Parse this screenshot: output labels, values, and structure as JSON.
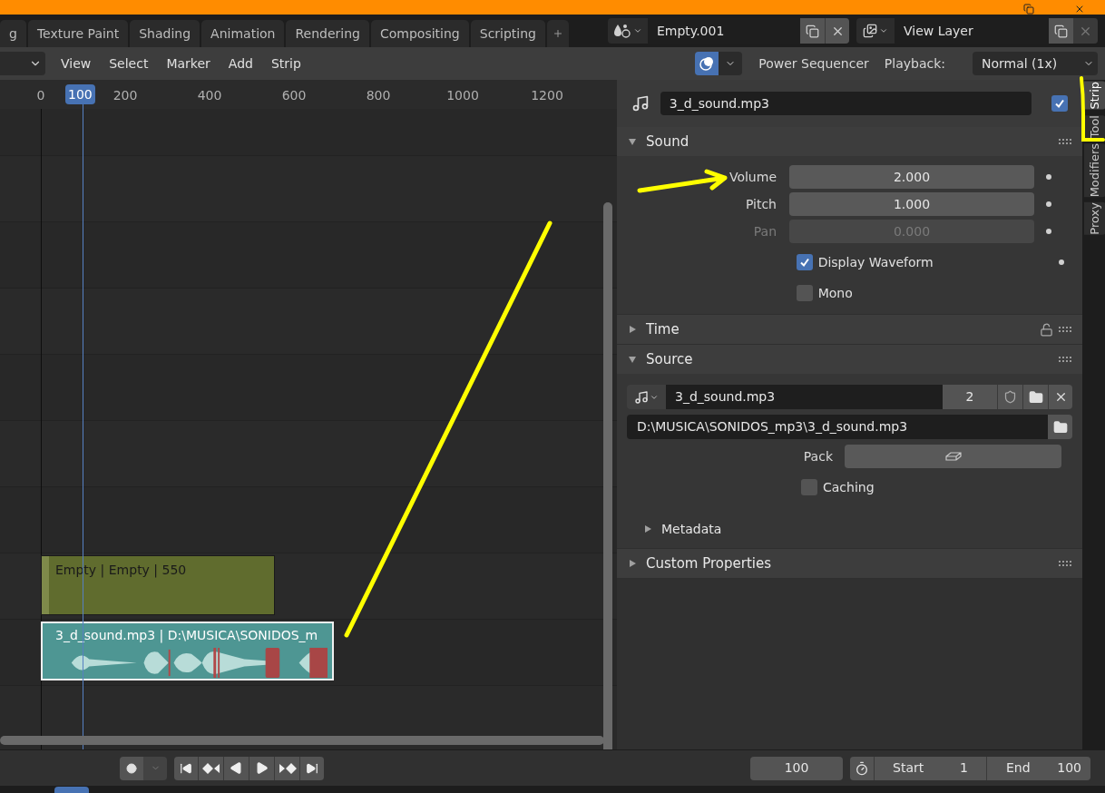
{
  "workspace_tabs": [
    {
      "label": "g",
      "selected": false
    },
    {
      "label": "Texture Paint",
      "selected": false
    },
    {
      "label": "Shading",
      "selected": false
    },
    {
      "label": "Animation",
      "selected": false
    },
    {
      "label": "Rendering",
      "selected": false
    },
    {
      "label": "Compositing",
      "selected": false
    },
    {
      "label": "Scripting",
      "selected": false
    }
  ],
  "scene": {
    "name": "Empty.001"
  },
  "view_layer": {
    "name": "View Layer"
  },
  "header": {
    "menus": [
      "View",
      "Select",
      "Marker",
      "Add",
      "Strip"
    ],
    "addon": "Power Sequencer",
    "playback": {
      "label": "Playback:",
      "value": "Normal (1x)"
    }
  },
  "timeline": {
    "ticks": [
      "0",
      "200",
      "400",
      "600",
      "800",
      "1000",
      "1200"
    ],
    "current_frame": "100",
    "strips": [
      {
        "kind": "effect",
        "label": "Empty | Empty | 550",
        "selected": false
      },
      {
        "kind": "sound",
        "label": "3_d_sound.mp3 | D:\\MUSICA\\SONIDOS_m",
        "selected": true
      }
    ]
  },
  "sidebar": {
    "strip": {
      "name": "3_d_sound.mp3",
      "enabled": true
    },
    "tabs": [
      {
        "label": "Strip",
        "selected": true
      },
      {
        "label": "Tool",
        "selected": false
      },
      {
        "label": "Modifiers",
        "selected": false
      },
      {
        "label": "Proxy",
        "selected": false
      }
    ],
    "panels": [
      {
        "kind": "sound",
        "title": "Sound",
        "expanded": true,
        "fields": [
          {
            "label": "Volume",
            "value": "2.000",
            "disabled": false
          },
          {
            "label": "Pitch",
            "value": "1.000",
            "disabled": false
          },
          {
            "label": "Pan",
            "value": "0.000",
            "disabled": true
          }
        ],
        "checkboxes": [
          {
            "label": "Display Waveform",
            "checked": true,
            "keyframe_dot": true
          },
          {
            "label": "Mono",
            "checked": false,
            "keyframe_dot": false
          }
        ]
      },
      {
        "kind": "time",
        "title": "Time",
        "expanded": false
      },
      {
        "kind": "source",
        "title": "Source",
        "expanded": true,
        "sound": "3_d_sound.mp3",
        "users": "2",
        "filepath": "D:\\MUSICA\\SONIDOS_mp3\\3_d_sound.mp3",
        "pack_label": "Pack",
        "caching": {
          "label": "Caching",
          "checked": false
        },
        "subpanel": {
          "title": "Metadata",
          "expanded": false
        }
      },
      {
        "kind": "custom",
        "title": "Custom Properties",
        "expanded": false
      }
    ]
  },
  "playback_bar": {
    "current_frame": "100",
    "start": {
      "label": "Start",
      "value": "1"
    },
    "end": {
      "label": "End",
      "value": "100"
    }
  }
}
